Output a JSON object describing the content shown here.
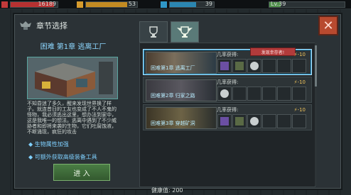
{
  "topbar": {
    "res1_value": "16189",
    "res2_value": "53",
    "res3_value": "39",
    "level_label": "Lv.39"
  },
  "panel": {
    "title": "章节选择",
    "close_symbol": "✕"
  },
  "left": {
    "chapter_title": "困难 第1章 逃离工厂",
    "description": "不知昏迷了多久，醒来发现世界换了样子。就连昔日的工友也变成了不人不鬼的怪物，我必须逃出这里，想办法到家中，这是我唯一的想法。逃离中遇到了不少威胁者和即将来袭的生物，它们吐腐蚀液，不断涌现，疯狂的攻击",
    "feature1": "生物属性加强",
    "feature2": "可额外获取高级装备工具",
    "enter_label": "进 入"
  },
  "list": {
    "rows": [
      {
        "name": "困难第1章 逃离工厂",
        "drop_label": "几率获得:",
        "energy": "-10",
        "tag": "发现幸存者!"
      },
      {
        "name": "困难第2章 归家之路",
        "drop_label": "几率获得:",
        "energy": "-10"
      },
      {
        "name": "困难第3章 穿越矿洞",
        "drop_label": "几率获得:",
        "energy": "-10"
      }
    ]
  },
  "footer": {
    "health": "健康值: 200"
  },
  "icons": [
    "helmet-badge-icon",
    "trophy-icon",
    "close-icon",
    "energy-icon",
    "gear-item-icon",
    "fuel-can-icon",
    "coin-icon",
    "battery-item-icon",
    "ore-icon"
  ],
  "colors": {
    "accent_blue": "#8dd7ff",
    "close_red": "#b84a2f",
    "enter_green": "#4a7d44",
    "tag_red": "#b23b3b"
  }
}
